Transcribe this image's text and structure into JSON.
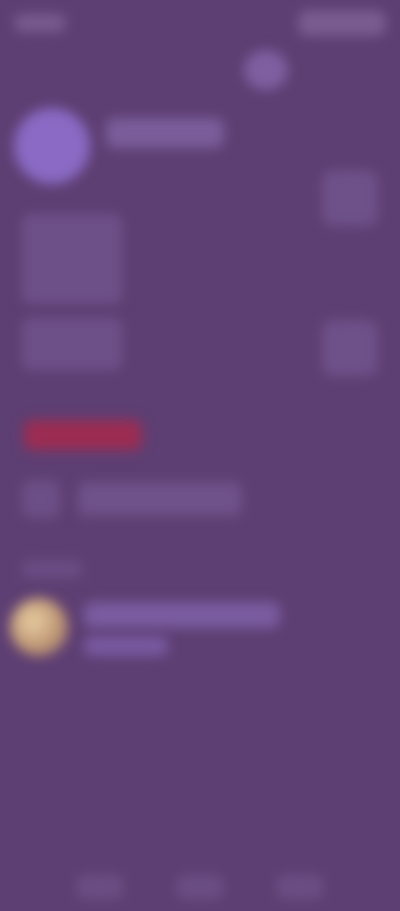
{
  "colors": {
    "background": "#5e3f73",
    "accent_red": "#9c2c52",
    "avatar_purple": "#8a6ac4"
  },
  "icons": {
    "header": "circle-icon",
    "row": "list-icon",
    "nav": [
      "home-icon",
      "search-icon",
      "profile-icon"
    ]
  }
}
